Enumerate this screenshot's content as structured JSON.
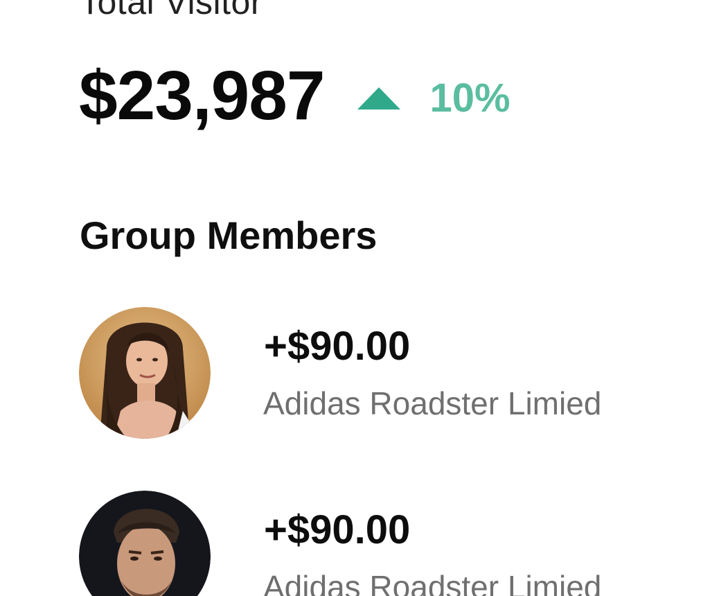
{
  "summary": {
    "title": "Total Visitor",
    "value": "$23,987",
    "trend_icon": "triangle-up-icon",
    "trend_percent": "10%",
    "trend_icon_color": "#2fa98a",
    "trend_text_color": "#5bbd9f"
  },
  "group": {
    "title": "Group Members",
    "members": [
      {
        "amount": "+$90.00",
        "name": "Adidas Roadster Limied",
        "avatar": "woman-portrait-avatar"
      },
      {
        "amount": "+$90.00",
        "name": "Adidas Roadster Limied",
        "avatar": "man-portrait-avatar"
      }
    ]
  }
}
